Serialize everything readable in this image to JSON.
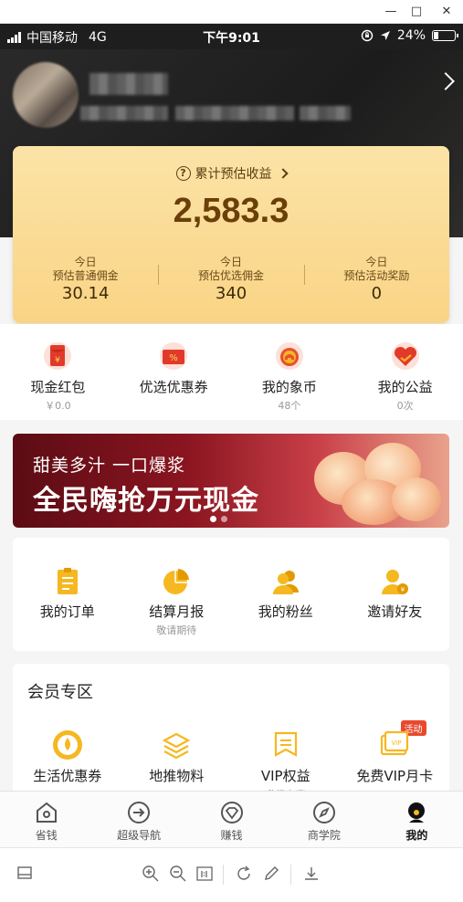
{
  "window": {
    "minimize": "—",
    "maximize": "□",
    "close": "✕"
  },
  "status_bar": {
    "carrier": "中国移动",
    "network": "4G",
    "time": "下午9:01",
    "battery": "24%",
    "battery_level": 0.24
  },
  "earnings": {
    "title": "累计预估收益",
    "total": "2,583.3",
    "stats": [
      {
        "line1": "今日",
        "line2": "预估普通佣金",
        "value": "30.14"
      },
      {
        "line1": "今日",
        "line2": "预估优选佣金",
        "value": "340"
      },
      {
        "line1": "今日",
        "line2": "预估活动奖励",
        "value": "0"
      }
    ]
  },
  "quick": [
    {
      "label": "现金红包",
      "sub": "￥0.0",
      "icon": "red-envelope-icon"
    },
    {
      "label": "优选优惠券",
      "sub": "",
      "icon": "coupon-icon"
    },
    {
      "label": "我的象币",
      "sub": "48个",
      "icon": "elephant-coin-icon"
    },
    {
      "label": "我的公益",
      "sub": "0次",
      "icon": "charity-heart-icon"
    }
  ],
  "banner": {
    "line1": "甜美多汁  一口爆浆",
    "line2": "全民嗨抢万元现金"
  },
  "orders": [
    {
      "label": "我的订单",
      "sub": ""
    },
    {
      "label": "结算月报",
      "sub": "敬请期待"
    },
    {
      "label": "我的粉丝",
      "sub": ""
    },
    {
      "label": "邀请好友",
      "sub": ""
    }
  ],
  "member": {
    "title": "会员专区",
    "items": [
      {
        "label": "生活优惠券",
        "sub": ""
      },
      {
        "label": "地推物料",
        "sub": ""
      },
      {
        "label": "VIP权益",
        "sub": "升级专享"
      },
      {
        "label": "免费VIP月卡",
        "sub": "",
        "tag": "活动",
        "icon_text": "VIP"
      }
    ]
  },
  "tabs": [
    {
      "label": "省钱"
    },
    {
      "label": "超级导航"
    },
    {
      "label": "赚钱"
    },
    {
      "label": "商学院"
    },
    {
      "label": "我的",
      "active": true
    }
  ],
  "colors": {
    "accent": "#f5b820",
    "card_gold": "#fad485",
    "banner_red": "#8a1520"
  }
}
